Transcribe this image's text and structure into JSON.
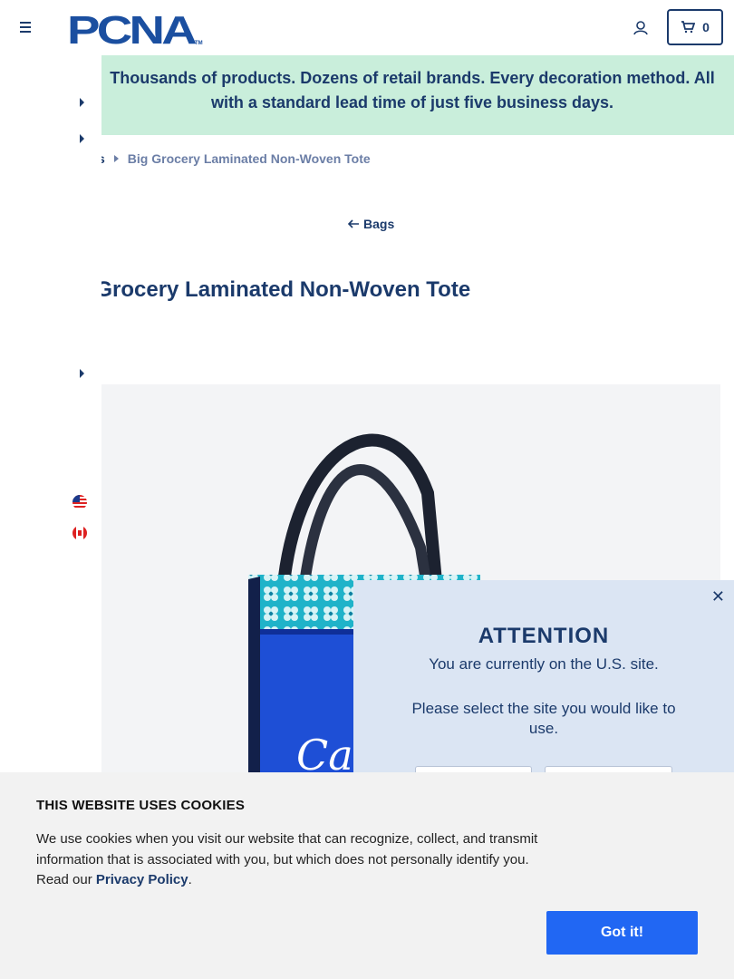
{
  "header": {
    "logo_text": "PCNA",
    "logo_tm": "TM",
    "cart_count": "0"
  },
  "banner": {
    "text": "Thousands of products. Dozens of retail brands. Every decoration method. All with a standard lead time of just five business days."
  },
  "breadcrumb": {
    "parent": "Bags",
    "parent_visible": "s",
    "current": "Big Grocery Laminated Non-Woven Tote"
  },
  "back_link": {
    "label": "Bags"
  },
  "product": {
    "title": "Big Grocery Laminated Non-Woven Tote",
    "image_text": "Can"
  },
  "modal": {
    "close": "✕",
    "title": "ATTENTION",
    "line1": "You are currently on the U.S. site.",
    "line2": "Please select the site you would like to use."
  },
  "cookie": {
    "title": "THIS WEBSITE USES COOKIES",
    "text_before": "We use cookies when you visit our website that can recognize, collect, and transmit information that is associated with you, but which does not personally identify you. Read our ",
    "link": "Privacy Policy",
    "text_after": ".",
    "button": "Got it!"
  },
  "colors": {
    "brand_navy": "#1b3a6b",
    "banner_green": "#c9eedb",
    "cookie_button": "#2167f3",
    "modal_bg": "#dbe5f3"
  }
}
